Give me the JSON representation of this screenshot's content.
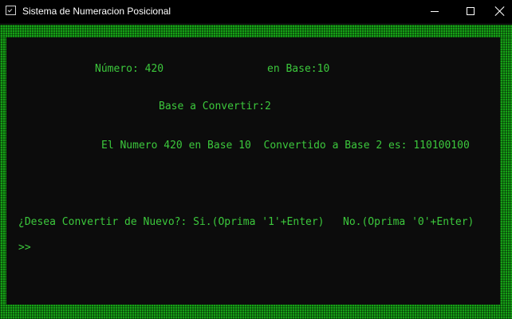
{
  "window": {
    "title": "Sistema de Numeracion Posicional",
    "app_icon": "console-icon",
    "controls": [
      "minimize-icon",
      "maximize-icon",
      "close-icon"
    ]
  },
  "console": {
    "border_color": "#16a016",
    "text_color": "#3cc83c",
    "background": "#0c0c0c",
    "lines": {
      "numero": "Número: 420",
      "en_base": "en Base:10",
      "base_convertir": "Base a Convertir:2",
      "resultado": "El Numero 420 en Base 10  Convertido a Base 2 es: 110100100",
      "pregunta": "¿Desea Convertir de Nuevo?: Si.(Oprima '1'+Enter)   No.(Oprima '0'+Enter)",
      "prompt": ">>"
    }
  }
}
